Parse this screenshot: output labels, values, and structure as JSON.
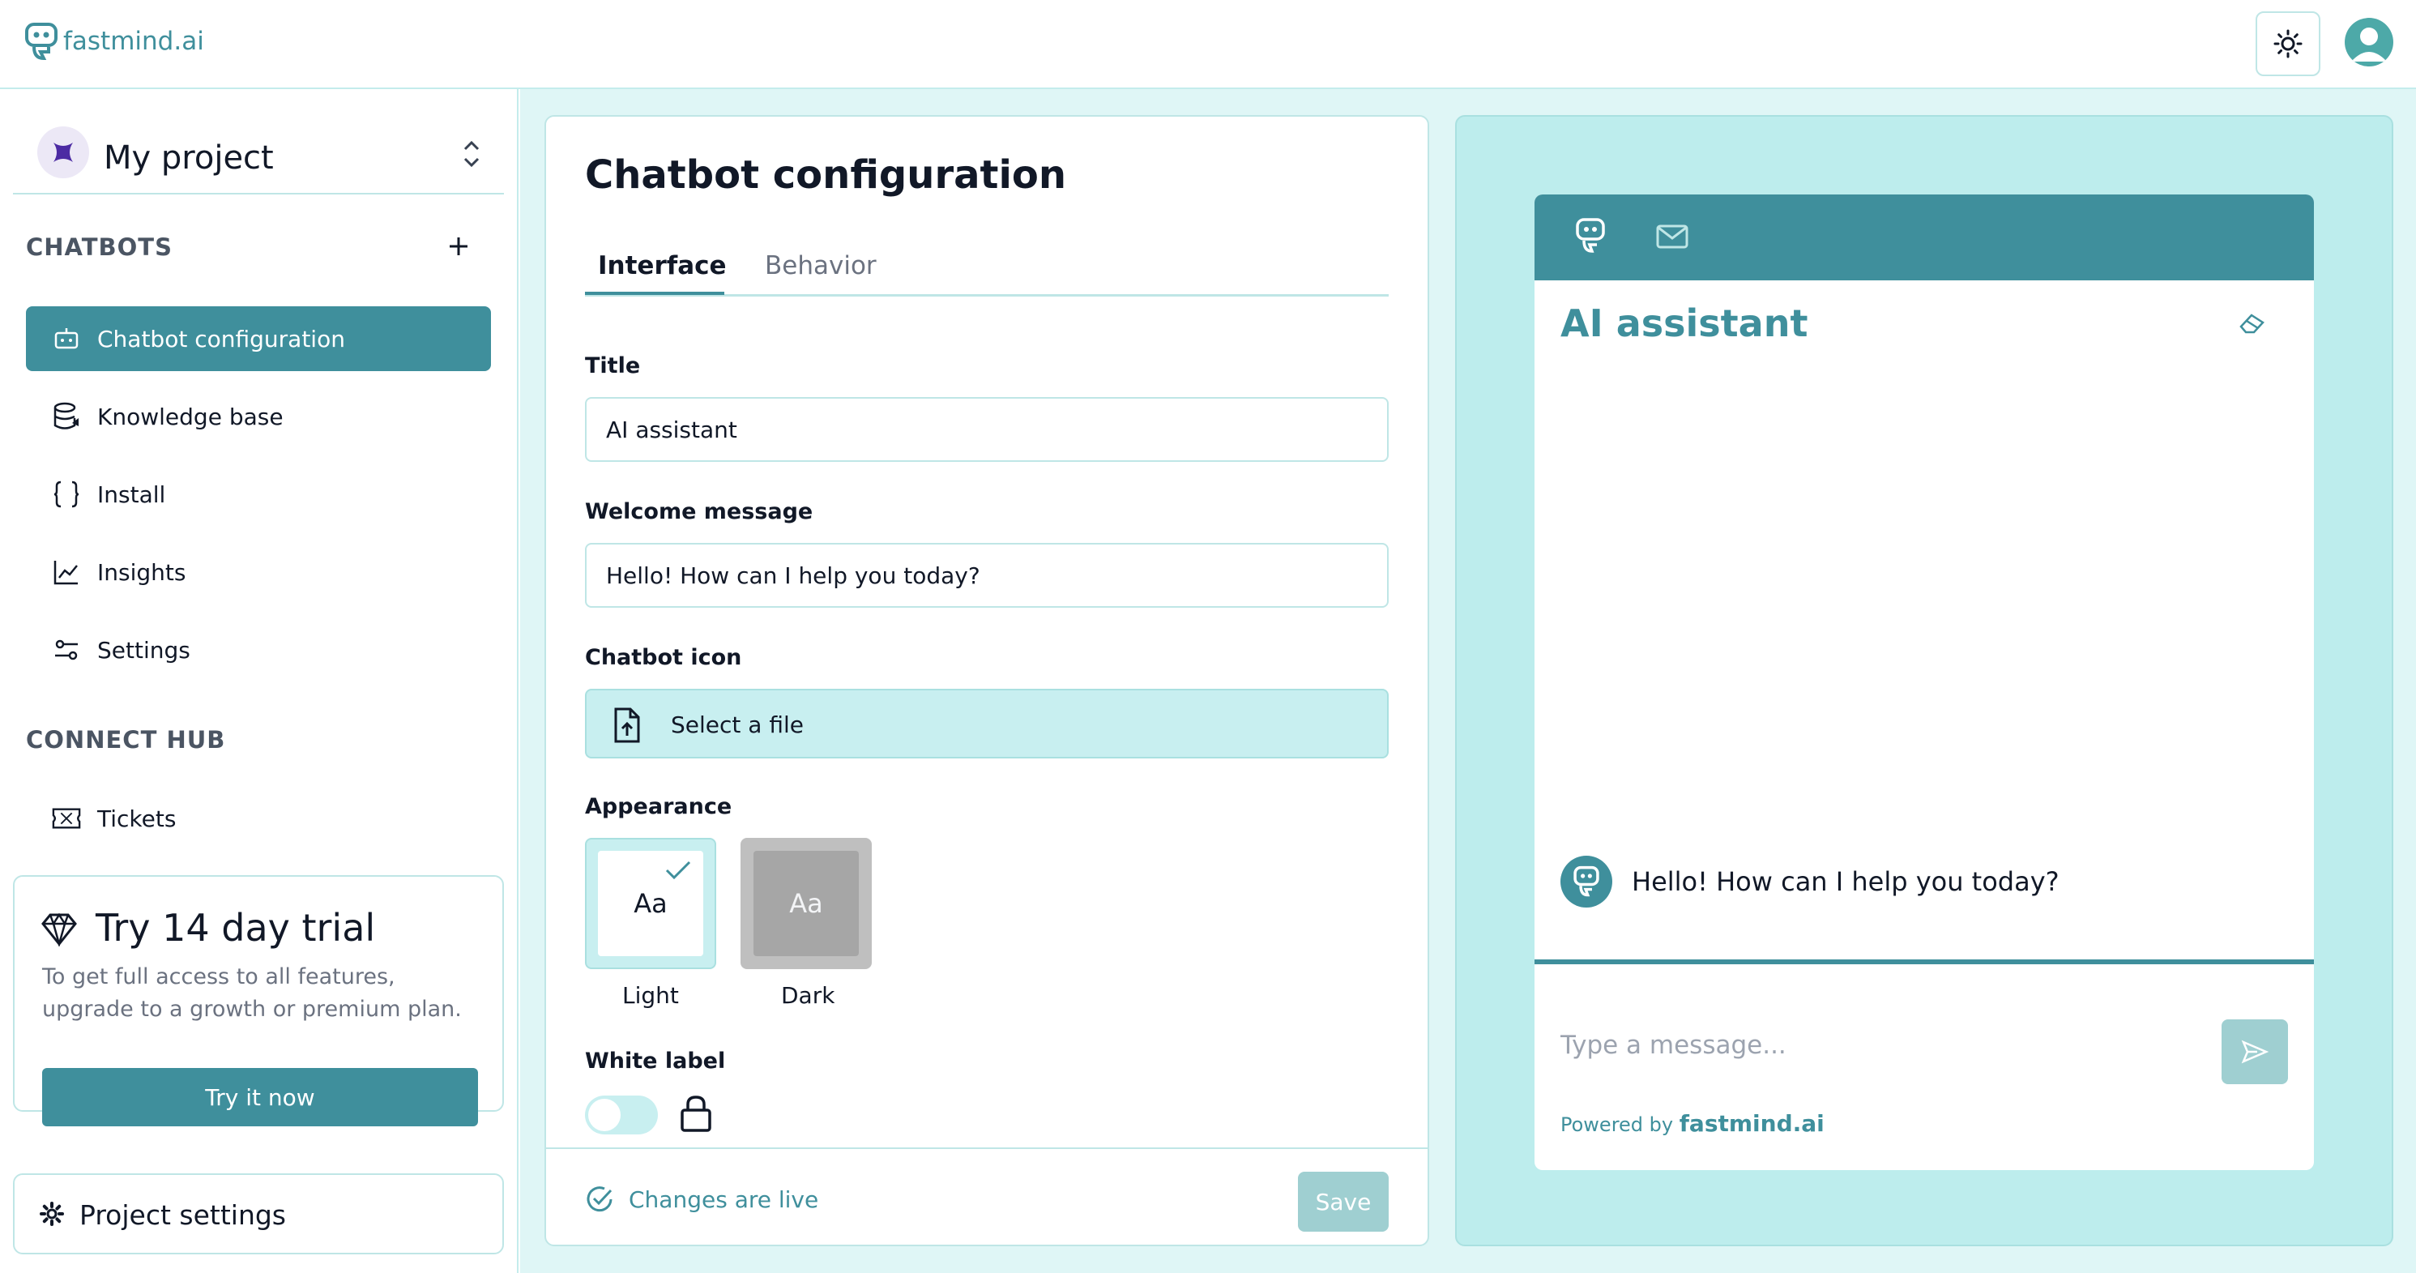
{
  "brand": {
    "name": "fastmind.ai",
    "accent_color": "#3f8f9c",
    "light_accent": "#c8eff0"
  },
  "header": {
    "theme_toggle_icon": "sun-icon",
    "avatar_icon": "user-avatar-icon"
  },
  "sidebar": {
    "project": {
      "name": "My project",
      "icon": "project-x-icon"
    },
    "chatbots_label": "CHATBOTS",
    "items": [
      {
        "label": "Chatbot configuration",
        "icon": "bot-icon",
        "active": true
      },
      {
        "label": "Knowledge base",
        "icon": "database-icon"
      },
      {
        "label": "Install",
        "icon": "braces-icon"
      },
      {
        "label": "Insights",
        "icon": "chart-line-icon"
      },
      {
        "label": "Settings",
        "icon": "sliders-icon"
      }
    ],
    "connect_hub_label": "CONNECT HUB",
    "hub_items": [
      {
        "label": "Tickets",
        "icon": "ticket-icon"
      }
    ],
    "trial": {
      "title": "Try 14 day trial",
      "description": "To get full access to all features, upgrade to a growth or premium plan.",
      "button": "Try it now"
    },
    "project_settings": "Project settings"
  },
  "config": {
    "title": "Chatbot configuration",
    "tabs": [
      "Interface",
      "Behavior"
    ],
    "active_tab": "Interface",
    "fields": {
      "title_label": "Title",
      "title_value": "AI assistant",
      "welcome_label": "Welcome message",
      "welcome_value": "Hello! How can I help you today?",
      "icon_label": "Chatbot icon",
      "file_button": "Select a file",
      "appearance_label": "Appearance",
      "appearance_options": [
        {
          "preview": "Aa",
          "name": "Light",
          "selected": true
        },
        {
          "preview": "Aa",
          "name": "Dark",
          "selected": false
        }
      ],
      "white_label_label": "White label",
      "white_label_enabled": false
    },
    "footer": {
      "status": "Changes are live",
      "save": "Save"
    }
  },
  "preview": {
    "title": "AI assistant",
    "welcome": "Hello! How can I help you today?",
    "input_placeholder": "Type a message...",
    "powered_by": "Powered by",
    "powered_brand": "fastmind.ai"
  }
}
